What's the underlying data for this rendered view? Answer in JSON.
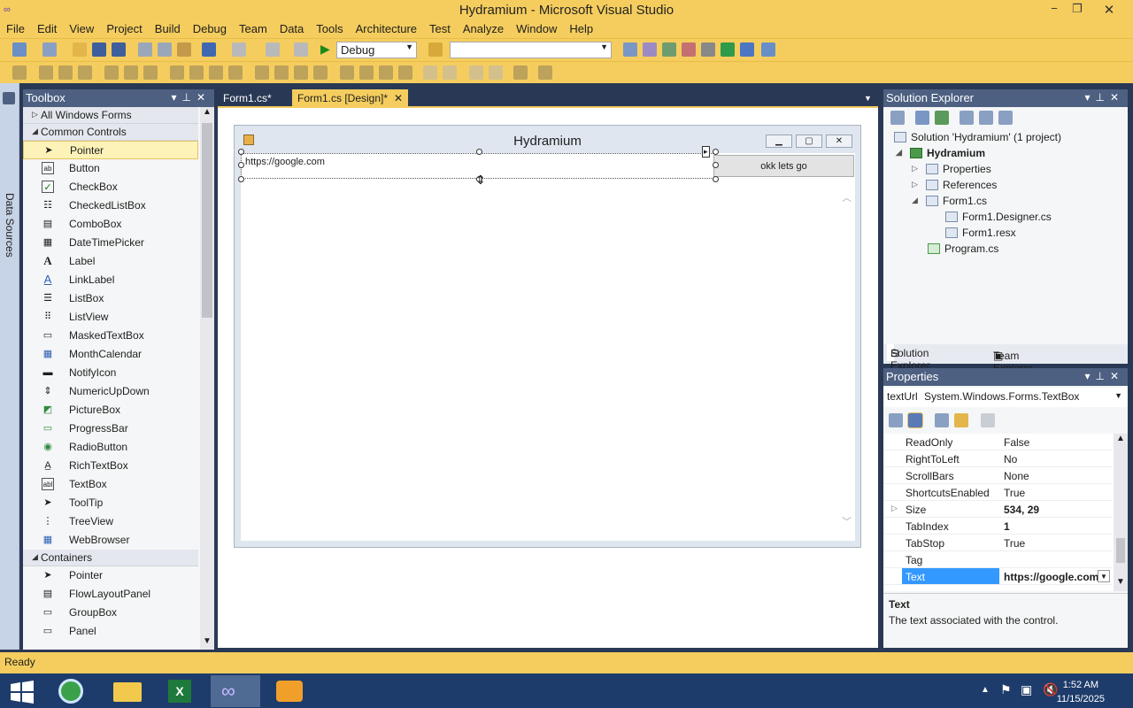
{
  "window": {
    "title": "Hydramium - Microsoft Visual Studio"
  },
  "menu": [
    "File",
    "Edit",
    "View",
    "Project",
    "Build",
    "Debug",
    "Team",
    "Data",
    "Tools",
    "Architecture",
    "Test",
    "Analyze",
    "Window",
    "Help"
  ],
  "toolbar": {
    "config": "Debug",
    "platform": ""
  },
  "left_strip": {
    "label": "Data Sources"
  },
  "toolbox": {
    "title": "Toolbox",
    "group_all": "All Windows Forms",
    "group_common": "Common Controls",
    "items": [
      "Pointer",
      "Button",
      "CheckBox",
      "CheckedListBox",
      "ComboBox",
      "DateTimePicker",
      "Label",
      "LinkLabel",
      "ListBox",
      "ListView",
      "MaskedTextBox",
      "MonthCalendar",
      "NotifyIcon",
      "NumericUpDown",
      "PictureBox",
      "ProgressBar",
      "RadioButton",
      "RichTextBox",
      "TextBox",
      "ToolTip",
      "TreeView",
      "WebBrowser"
    ],
    "group_containers": "Containers",
    "container_items": [
      "Pointer",
      "FlowLayoutPanel",
      "GroupBox",
      "Panel"
    ]
  },
  "tabs": [
    "Form1.cs*",
    "Form1.cs [Design]*"
  ],
  "form": {
    "caption": "Hydramium",
    "textbox_value": "https://google.com",
    "button_label": "okk lets go"
  },
  "solution_explorer": {
    "title": "Solution Explorer",
    "solution": "Solution 'Hydramium' (1 project)",
    "project": "Hydramium",
    "nodes": [
      "Properties",
      "References",
      "Form1.cs",
      "Form1.Designer.cs",
      "Form1.resx",
      "Program.cs"
    ],
    "tab_solution": "Solution Explorer",
    "tab_team": "Team Explorer"
  },
  "properties": {
    "title": "Properties",
    "object_name": "textUrl",
    "object_type": "System.Windows.Forms.TextBox",
    "rows": [
      {
        "name": "ReadOnly",
        "value": "False"
      },
      {
        "name": "RightToLeft",
        "value": "No"
      },
      {
        "name": "ScrollBars",
        "value": "None"
      },
      {
        "name": "ShortcutsEnabled",
        "value": "True"
      },
      {
        "name": "Size",
        "value": "534, 29"
      },
      {
        "name": "TabIndex",
        "value": "1"
      },
      {
        "name": "TabStop",
        "value": "True"
      },
      {
        "name": "Tag",
        "value": ""
      },
      {
        "name": "Text",
        "value": "https://google.com"
      }
    ],
    "desc_title": "Text",
    "desc_text": "The text associated with the control."
  },
  "status": "Ready",
  "clock": {
    "time": "1:52 AM",
    "date": "11/15/2025"
  },
  "colors": {
    "accent": "#f5cd5e",
    "panel_dark": "#293955",
    "selection": "#3399ff"
  }
}
